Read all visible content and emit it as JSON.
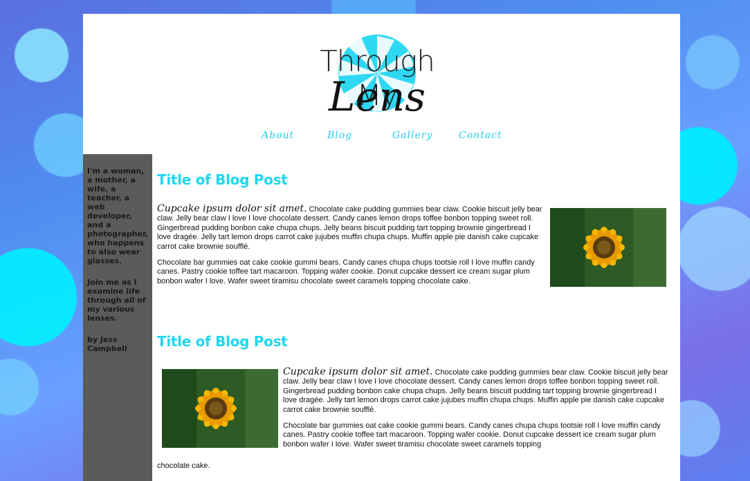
{
  "logo": {
    "line1": "Through My",
    "line2": "Lens"
  },
  "nav": {
    "about": "About",
    "blog": "Blog",
    "gallery": "Gallery",
    "contact": "Contact"
  },
  "sidebar": {
    "bio": "I'm a woman, a mother, a wife, a teacher, a web developer, and a photographer, who happens to also wear glasses.",
    "invite": "Join me as I examine life through all of my various lenses.",
    "byline": "by Jess Campbell"
  },
  "posts": [
    {
      "title": "Title of Blog Post",
      "lead": "Cupcake ipsum dolor sit amet.",
      "p1": " Chocolate cake pudding gummies bear claw. Cookie biscuit jelly bear claw. Jelly bear claw I love I love chocolate dessert. Candy canes lemon drops toffee bonbon topping sweet roll. Gingerbread pudding bonbon cake chupa chups. Jelly beans biscuit pudding tart topping brownie gingerbread I love dragée. Jelly tart lemon drops carrot cake jujubes muffin chupa chups. Muffin apple pie danish cake cupcake carrot cake brownie soufflé.",
      "p2": "Chocolate bar gummies oat cake cookie gummi bears. Candy canes chupa chups tootsie roll I love muffin candy canes. Pastry cookie toffee tart macaroon. Topping wafer cookie. Donut cupcake dessert ice cream sugar plum bonbon wafer I love. Wafer sweet tiramisu chocolate sweet caramels topping chocolate cake."
    },
    {
      "title": "Title of Blog Post",
      "lead": "Cupcake ipsum dolor sit amet.",
      "p1": " Chocolate cake pudding gummies bear claw. Cookie biscuit jelly bear claw. Jelly bear claw I love I love chocolate dessert. Candy canes lemon drops toffee bonbon topping sweet roll. Gingerbread pudding bonbon cake chupa chups. Jelly beans biscuit pudding tart topping brownie gingerbread I love dragée. Jelly tart lemon drops carrot cake jujubes muffin chupa chups. Muffin apple pie danish cake cupcake carrot cake brownie soufflé.",
      "p2": "Chocolate bar gummies oat cake cookie gummi bears. Candy canes chupa chups tootsie roll I love muffin candy canes. Pastry cookie toffee tart macaroon. Topping wafer cookie. Donut cupcake dessert ice cream sugar plum bonbon wafer I love. Wafer sweet tiramisu chocolate sweet caramels topping",
      "p2_tail": "chocolate cake."
    }
  ],
  "colors": {
    "accent": "#20d6f0",
    "sidebar": "#5b5b5b",
    "page": "#ffffff"
  }
}
